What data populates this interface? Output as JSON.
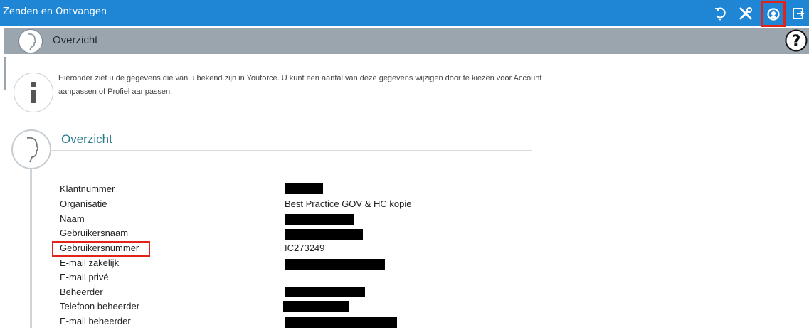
{
  "app": {
    "title": "Zenden en Ontvangen",
    "icons": [
      "refresh-icon",
      "tools-icon",
      "user-circle-icon",
      "logout-icon"
    ]
  },
  "subheader": {
    "title": "Overzicht",
    "help_icon": "question-circle-icon"
  },
  "info": {
    "text": "Hieronder ziet u de gegevens die van u bekend zijn in Youforce. U kunt een aantal van deze gegevens wijzigen door te kiezen voor Account aanpassen of Profiel aanpassen."
  },
  "section": {
    "title": "Overzicht"
  },
  "details": [
    {
      "label": "Klantnummer",
      "value": "",
      "redacted": true
    },
    {
      "label": "Organisatie",
      "value": "Best Practice GOV & HC kopie",
      "redacted": false
    },
    {
      "label": "Naam",
      "value": "",
      "redacted": true
    },
    {
      "label": "Gebruikersnaam",
      "value": "",
      "redacted": true
    },
    {
      "label": "Gebruikersnummer",
      "value": "IC273249",
      "redacted": false
    },
    {
      "label": "E-mail zakelijk",
      "value": "",
      "redacted": true
    },
    {
      "label": "E-mail privé",
      "value": "",
      "redacted": false
    },
    {
      "label": "Beheerder",
      "value": "",
      "redacted": true
    },
    {
      "label": "Telefoon beheerder",
      "value": "",
      "redacted": true
    },
    {
      "label": "E-mail beheerder",
      "value": "",
      "redacted": true
    }
  ],
  "colors": {
    "topbar": "#1f86d6",
    "subheader": "#9aa5ae",
    "section_title": "#2a7a8c",
    "highlight": "#e2231a"
  }
}
